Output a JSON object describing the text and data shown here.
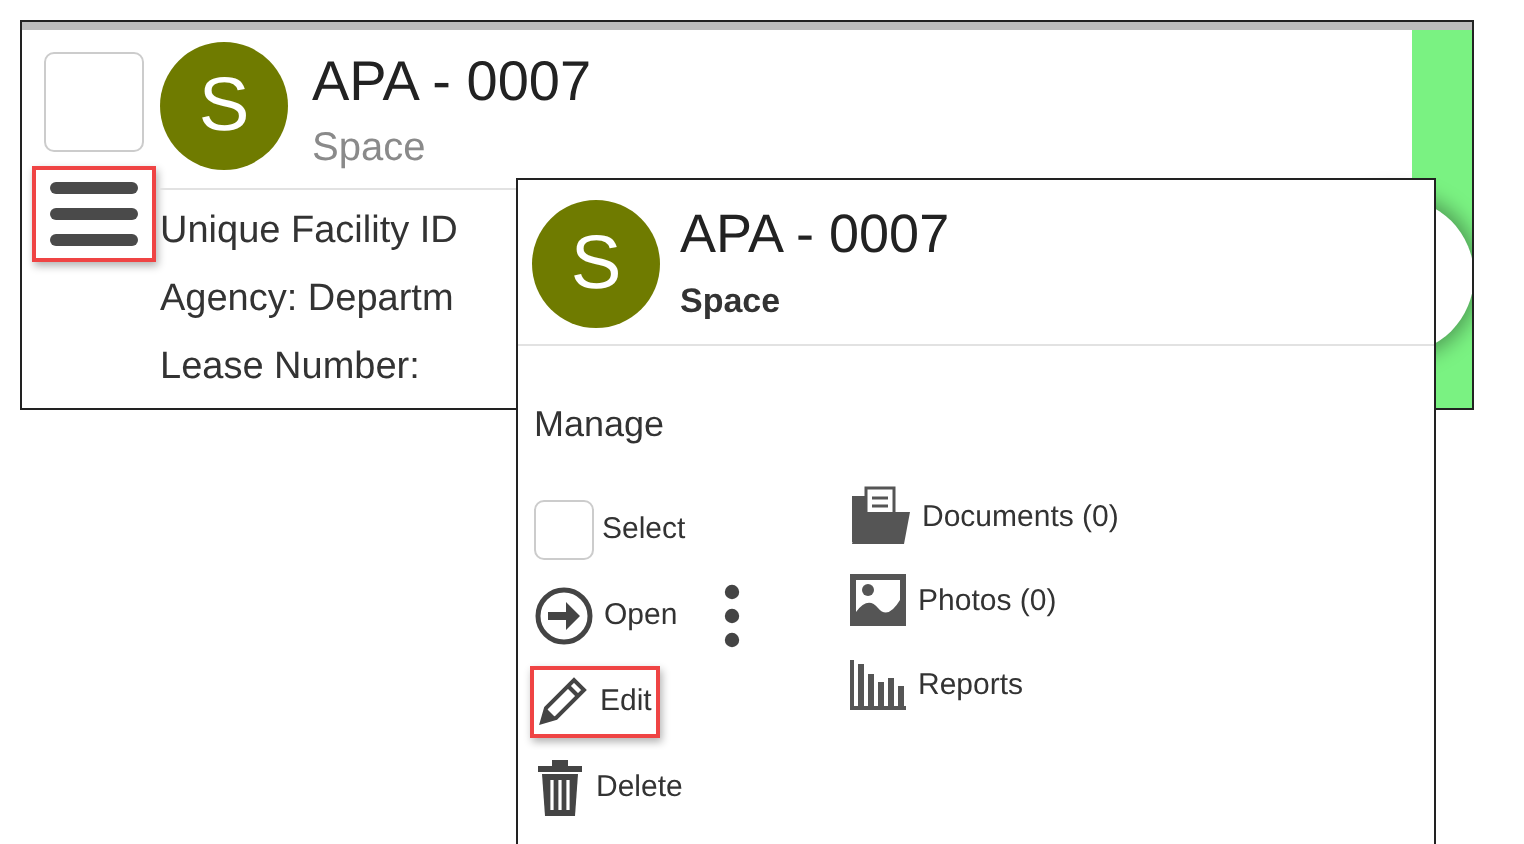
{
  "card": {
    "checked": false,
    "avatar": "S",
    "title": "APA - 0007",
    "subtitle": "Space",
    "menu_highlighted": true,
    "fields": [
      "Unique Facility ID",
      "Agency: Departm",
      "Lease Number:"
    ]
  },
  "popup": {
    "avatar": "S",
    "title": "APA - 0007",
    "subtitle": "Space",
    "section": "Manage",
    "left_actions": [
      {
        "kind": "checkbox",
        "label": "Select",
        "checked": false,
        "highlighted": false
      },
      {
        "kind": "open",
        "label": "Open",
        "highlighted": false
      },
      {
        "kind": "edit",
        "label": "Edit",
        "highlighted": true
      },
      {
        "kind": "delete",
        "label": "Delete",
        "highlighted": false
      }
    ],
    "right_actions": [
      {
        "kind": "documents",
        "label": "Documents (0)"
      },
      {
        "kind": "photos",
        "label": "Photos (0)"
      },
      {
        "kind": "reports",
        "label": "Reports"
      }
    ]
  }
}
